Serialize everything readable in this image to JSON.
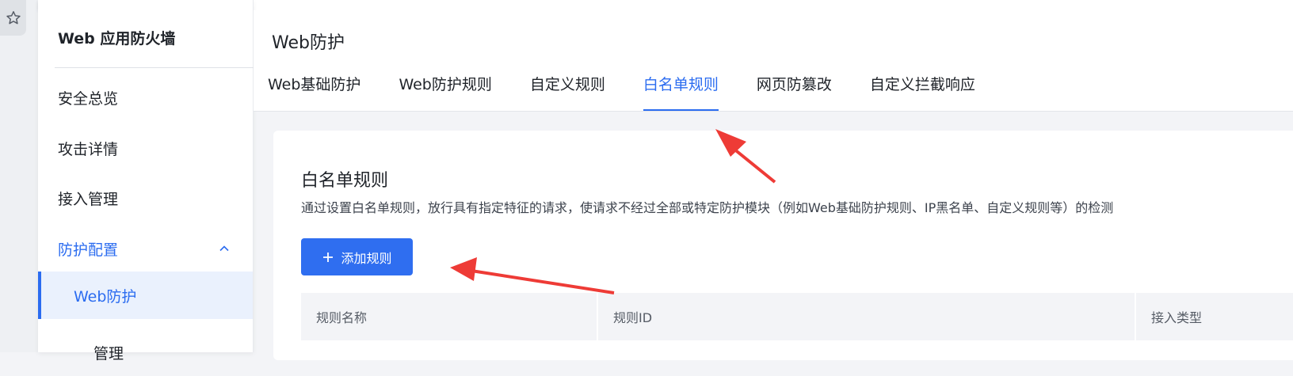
{
  "sidebar": {
    "title": "Web 应用防火墙",
    "items": [
      {
        "label": "安全总览"
      },
      {
        "label": "攻击详情"
      },
      {
        "label": "接入管理"
      },
      {
        "label": "防护配置"
      },
      {
        "label": "Web防护"
      },
      {
        "label": "管理"
      }
    ]
  },
  "header": {
    "title": "Web防护",
    "tabs": [
      {
        "label": "Web基础防护"
      },
      {
        "label": "Web防护规则"
      },
      {
        "label": "自定义规则"
      },
      {
        "label": "白名单规则"
      },
      {
        "label": "网页防篡改"
      },
      {
        "label": "自定义拦截响应"
      }
    ],
    "active_tab": "白名单规则"
  },
  "card": {
    "title": "白名单规则",
    "description": "通过设置白名单规则，放行具有指定特征的请求，使请求不经过全部或特定防护模块（例如Web基础防护规则、IP黑名单、自定义规则等）的检测",
    "add_button": "添加规则",
    "table_columns": [
      "规则名称",
      "规则ID",
      "接入类型"
    ]
  },
  "colors": {
    "accent": "#2b6cf0",
    "annotation_arrow": "#ee3b36"
  },
  "icons": [
    "star-icon",
    "chevron-up-icon",
    "plus-icon"
  ]
}
